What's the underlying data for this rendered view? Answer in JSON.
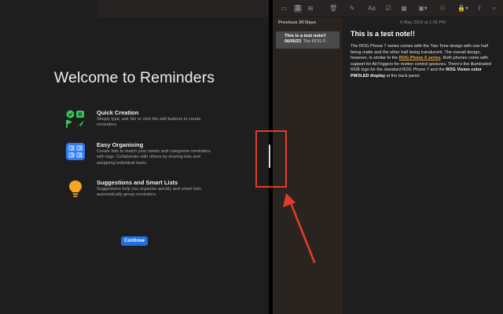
{
  "reminders": {
    "welcome_title": "Welcome to Reminders",
    "features": [
      {
        "icon": "quick-creation-icon",
        "title": "Quick Creation",
        "desc": "Simply type, ask Siri or click the edit buttons to create reminders."
      },
      {
        "icon": "easy-organising-icon",
        "title": "Easy Organising",
        "desc": "Create lists to match your needs and categorise reminders with tags. Collaborate with others by sharing lists and assigning individual tasks."
      },
      {
        "icon": "lightbulb-icon",
        "title": "Suggestions and Smart Lists",
        "desc": "Suggestions help you organise quickly and smart lists automatically group reminders."
      }
    ],
    "continue_label": "Continue"
  },
  "notes": {
    "toolbar": {
      "icons": [
        "sidebar-toggle-icon",
        "list-view-icon",
        "gallery-view-icon",
        "trash-icon",
        "compose-icon",
        "format-text-icon",
        "checklist-icon",
        "table-icon",
        "media-icon",
        "collaborate-icon",
        "lock-icon",
        "share-icon",
        "search-icon"
      ]
    },
    "list": {
      "section_header": "Previous 30 Days",
      "note": {
        "title": "This is a test note!!",
        "date": "06/05/23",
        "preview": "The ROG P..."
      }
    },
    "editor": {
      "date_line": "6 May 2023 at 1:06 PM",
      "title": "This is a test note!!",
      "body": {
        "p1": "The ROG Phone 7 series comes with the Two Tone design with one half being matte and the other half being translucent. The overall design, however, is similar to the ",
        "link": "ROG Phone 6 series",
        "p2": ". Both phones come with support for AirTriggers for motion control gestures. There's the illuminated RGB logo for the standard ROG Phone 7 and the ",
        "bold": "ROG Vision color PMOLED display",
        "p3": " at the back panel."
      }
    }
  },
  "colors": {
    "accent_blue": "#1f6fe0",
    "annotation_red": "#e03b2d",
    "link_orange": "#e8a93a",
    "feature_green": "#34c759",
    "feature_blue": "#2f7cf6",
    "feature_yellow": "#f5a623"
  }
}
